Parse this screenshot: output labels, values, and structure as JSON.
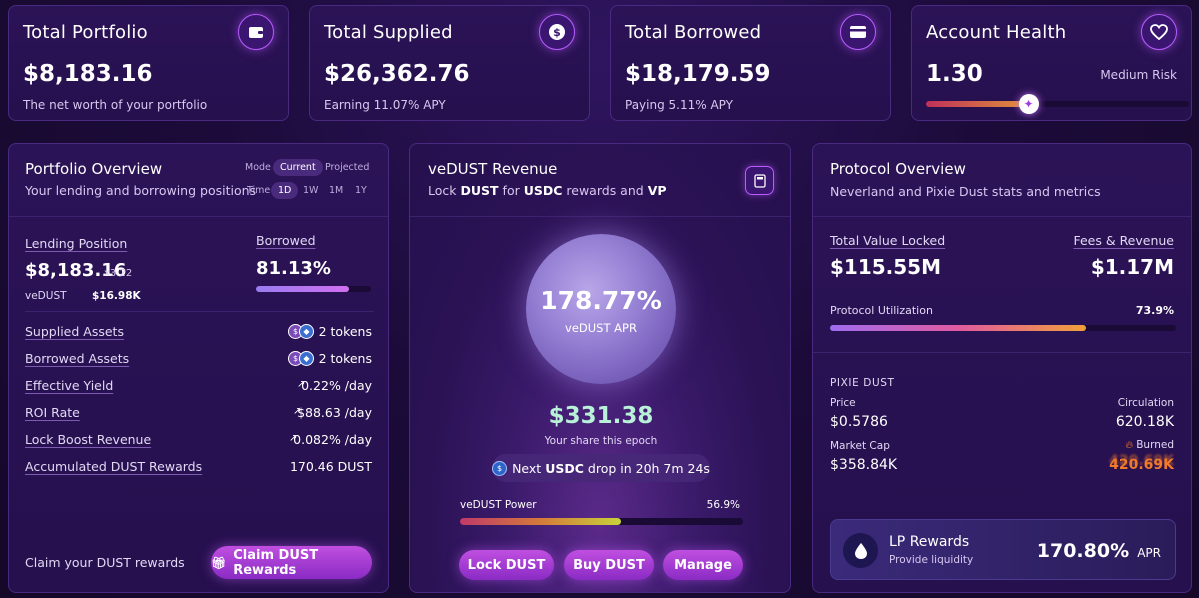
{
  "stats": {
    "total_portfolio": {
      "title": "Total Portfolio",
      "value": "$8,183.16",
      "sub": "The net worth of your portfolio",
      "icon": "wallet-icon"
    },
    "total_supplied": {
      "title": "Total Supplied",
      "value": "$26,362.76",
      "sub": "Earning 11.07% APY",
      "icon": "dollar-coin-icon"
    },
    "total_borrowed": {
      "title": "Total Borrowed",
      "value": "$18,179.59",
      "sub": "Paying 5.11% APY",
      "icon": "credit-card-icon"
    },
    "account_health": {
      "title": "Account Health",
      "value": "1.30",
      "risk": "Medium Risk",
      "icon": "heart-icon",
      "level": 0.39
    }
  },
  "portfolio_overview": {
    "title": "Portfolio Overview",
    "subtitle": "Your lending and borrowing positions",
    "mode_label": "Mode",
    "modes": [
      "Current",
      "Projected"
    ],
    "active_mode": "Current",
    "time_label": "Time",
    "times": [
      "1D",
      "1W",
      "1M",
      "1Y"
    ],
    "active_time": "1D",
    "lending_label": "Lending Position",
    "lending_value": "$8,183.16",
    "multiplier": "x3.22",
    "vedust_label": "veDUST",
    "vedust_value": "$16.98K",
    "borrowed_label": "Borrowed",
    "borrowed_value": "81.13%",
    "borrowed_ratio": 0.8113,
    "rows": [
      {
        "label": "Supplied Assets",
        "value": "2 tokens"
      },
      {
        "label": "Borrowed Assets",
        "value": "2 tokens"
      },
      {
        "label": "Effective Yield",
        "value": "0.22% /day"
      },
      {
        "label": "ROI Rate",
        "value": "$88.63 /day"
      },
      {
        "label": "Lock Boost Revenue",
        "value": "0.082% /day"
      },
      {
        "label": "Accumulated DUST Rewards",
        "value": "170.46 DUST"
      }
    ],
    "claim_text": "Claim your DUST rewards",
    "claim_button": "Claim DUST Rewards"
  },
  "vedust": {
    "title": "veDUST Revenue",
    "sub_prefix": "Lock",
    "sub_token": "DUST",
    "sub_mid": "for",
    "sub_reward": "USDC",
    "sub_and": "rewards and",
    "sub_vp": "VP",
    "apr_value": "178.77%",
    "apr_label": "veDUST APR",
    "share_value": "$331.38",
    "share_label": "Your share this epoch",
    "next_prefix": "Next",
    "next_token": "USDC",
    "next_suffix": "drop in 20h 7m 24s",
    "power_label": "veDUST Power",
    "power_value": "56.9%",
    "power_ratio": 0.569,
    "buttons": [
      "Lock DUST",
      "Buy DUST",
      "Manage"
    ]
  },
  "protocol": {
    "title": "Protocol Overview",
    "subtitle": "Neverland and Pixie Dust stats and metrics",
    "tvl_label": "Total Value Locked",
    "tvl_value": "$115.55M",
    "fees_label": "Fees & Revenue",
    "fees_value": "$1.17M",
    "util_label": "Protocol Utilization",
    "util_value": "73.9%",
    "util_ratio": 0.739,
    "pixie_heading": "PIXIE DUST",
    "price_label": "Price",
    "price_value": "$0.5786",
    "circ_label": "Circulation",
    "circ_value": "620.18K",
    "mcap_label": "Market Cap",
    "mcap_value": "$358.84K",
    "burned_label": "Burned",
    "burned_value": "420.69K",
    "lp_title": "LP Rewards",
    "lp_sub": "Provide liquidity",
    "lp_value": "170.80%",
    "lp_unit": "APR"
  }
}
